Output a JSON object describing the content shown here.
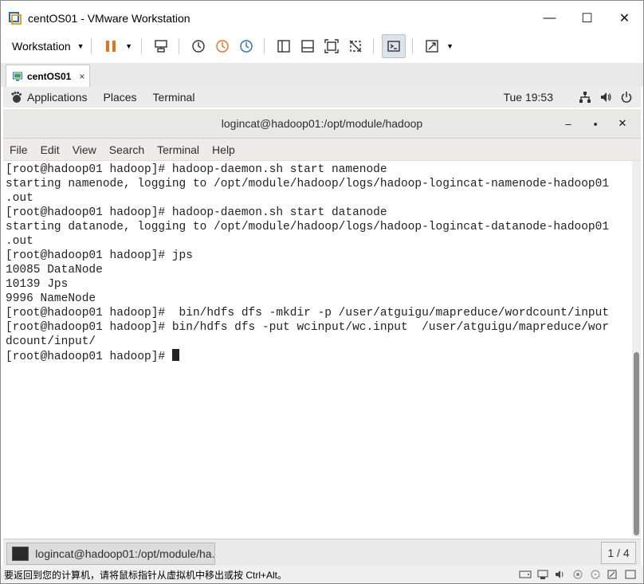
{
  "window": {
    "title": "centOS01 - VMware Workstation"
  },
  "window_controls": {
    "minimize": "—",
    "maximize": "☐",
    "close": "✕"
  },
  "toolbar": {
    "workstation_label": "Workstation"
  },
  "tab": {
    "label": "centOS01",
    "close": "×"
  },
  "gnome_bar": {
    "applications": "Applications",
    "places": "Places",
    "terminal": "Terminal",
    "clock": "Tue 19:53"
  },
  "terminal_window": {
    "title": "logincat@hadoop01:/opt/module/hadoop",
    "minimize": "–",
    "maximize": "▪",
    "close": "✕"
  },
  "terminal_menu": [
    "File",
    "Edit",
    "View",
    "Search",
    "Terminal",
    "Help"
  ],
  "terminal_lines": [
    "[root@hadoop01 hadoop]# hadoop-daemon.sh start namenode",
    "starting namenode, logging to /opt/module/hadoop/logs/hadoop-logincat-namenode-hadoop01",
    ".out",
    "[root@hadoop01 hadoop]# hadoop-daemon.sh start datanode",
    "starting datanode, logging to /opt/module/hadoop/logs/hadoop-logincat-datanode-hadoop01",
    ".out",
    "[root@hadoop01 hadoop]# jps",
    "10085 DataNode",
    "10139 Jps",
    "9996 NameNode",
    "[root@hadoop01 hadoop]#  bin/hdfs dfs -mkdir -p /user/atguigu/mapreduce/wordcount/input",
    "[root@hadoop01 hadoop]# bin/hdfs dfs -put wcinput/wc.input  /user/atguigu/mapreduce/wor",
    "dcount/input/",
    "[root@hadoop01 hadoop]# "
  ],
  "taskbar": {
    "task_label": "logincat@hadoop01:/opt/module/ha...",
    "pager": "1 / 4"
  },
  "statusbar": {
    "hint": "要返回到您的计算机，请将鼠标指针从虚拟机中移出或按 Ctrl+Alt。"
  },
  "colors": {
    "pause_accent": "#e8711c",
    "terminal_bg": "#ffffff",
    "terminal_fg": "#222222"
  }
}
